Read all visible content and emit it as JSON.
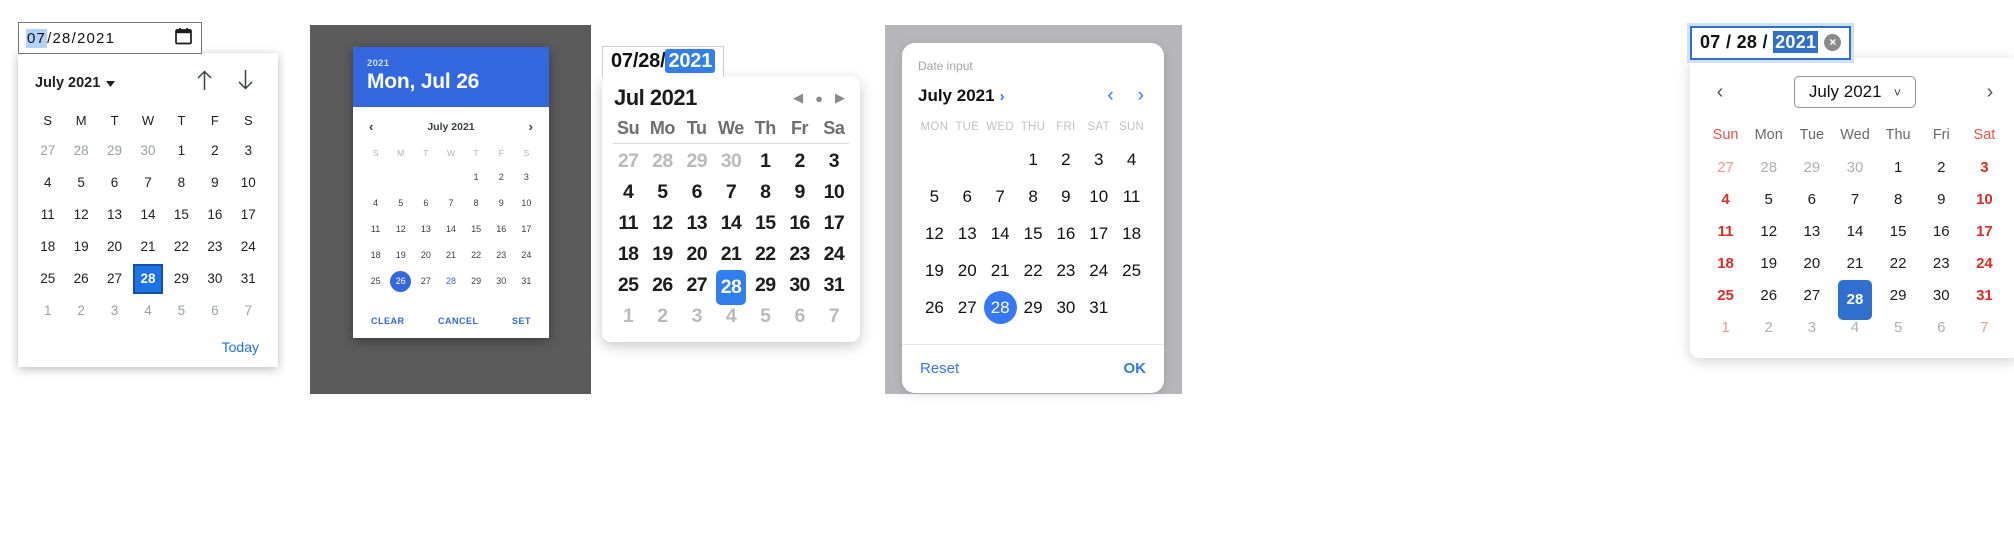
{
  "pickers": [
    {
      "id": "chrome-desktop",
      "input": {
        "month": "07",
        "sep1": "/",
        "day": "28",
        "sep2": "/",
        "year": "2021",
        "selected_segment": "month",
        "icon": "calendar-icon"
      },
      "header": {
        "title": "July 2021",
        "dropdown_icon": "caret-down-icon",
        "prev_icon": "arrow-up-icon",
        "next_icon": "arrow-down-icon"
      },
      "dow": [
        "S",
        "M",
        "T",
        "W",
        "T",
        "F",
        "S"
      ],
      "weeks": [
        [
          {
            "d": "27",
            "m": true
          },
          {
            "d": "28",
            "m": true
          },
          {
            "d": "29",
            "m": true
          },
          {
            "d": "30",
            "m": true
          },
          {
            "d": "1"
          },
          {
            "d": "2"
          },
          {
            "d": "3"
          }
        ],
        [
          {
            "d": "4"
          },
          {
            "d": "5"
          },
          {
            "d": "6"
          },
          {
            "d": "7"
          },
          {
            "d": "8"
          },
          {
            "d": "9"
          },
          {
            "d": "10"
          }
        ],
        [
          {
            "d": "11"
          },
          {
            "d": "12"
          },
          {
            "d": "13"
          },
          {
            "d": "14"
          },
          {
            "d": "15"
          },
          {
            "d": "16"
          },
          {
            "d": "17"
          }
        ],
        [
          {
            "d": "18"
          },
          {
            "d": "19"
          },
          {
            "d": "20"
          },
          {
            "d": "21"
          },
          {
            "d": "22"
          },
          {
            "d": "23"
          },
          {
            "d": "24"
          }
        ],
        [
          {
            "d": "25"
          },
          {
            "d": "26"
          },
          {
            "d": "27"
          },
          {
            "d": "28",
            "s": true
          },
          {
            "d": "29"
          },
          {
            "d": "30"
          },
          {
            "d": "31"
          }
        ],
        [
          {
            "d": "1",
            "m": true
          },
          {
            "d": "2",
            "m": true
          },
          {
            "d": "3",
            "m": true
          },
          {
            "d": "4",
            "m": true
          },
          {
            "d": "5",
            "m": true
          },
          {
            "d": "6",
            "m": true
          },
          {
            "d": "7",
            "m": true
          }
        ]
      ],
      "footer": {
        "today_label": "Today"
      },
      "accent": "#1a73e8"
    },
    {
      "id": "material-dialog",
      "header": {
        "year": "2021",
        "date": "Mon, Jul 26"
      },
      "nav": {
        "prev_icon": "chevron-left-icon",
        "title": "July 2021",
        "next_icon": "chevron-right-icon"
      },
      "dow": [
        "S",
        "M",
        "T",
        "W",
        "T",
        "F",
        "S"
      ],
      "weeks": [
        [
          {
            "d": ""
          },
          {
            "d": ""
          },
          {
            "d": ""
          },
          {
            "d": ""
          },
          {
            "d": "1"
          },
          {
            "d": "2"
          },
          {
            "d": "3"
          }
        ],
        [
          {
            "d": "4"
          },
          {
            "d": "5"
          },
          {
            "d": "6"
          },
          {
            "d": "7"
          },
          {
            "d": "8"
          },
          {
            "d": "9"
          },
          {
            "d": "10"
          }
        ],
        [
          {
            "d": "11"
          },
          {
            "d": "12"
          },
          {
            "d": "13"
          },
          {
            "d": "14"
          },
          {
            "d": "15"
          },
          {
            "d": "16"
          },
          {
            "d": "17"
          }
        ],
        [
          {
            "d": "18"
          },
          {
            "d": "19"
          },
          {
            "d": "20"
          },
          {
            "d": "21"
          },
          {
            "d": "22"
          },
          {
            "d": "23"
          },
          {
            "d": "24"
          }
        ],
        [
          {
            "d": "25"
          },
          {
            "d": "26",
            "s": true
          },
          {
            "d": "27"
          },
          {
            "d": "28",
            "t": true
          },
          {
            "d": "29"
          },
          {
            "d": "30"
          },
          {
            "d": "31"
          }
        ]
      ],
      "actions": {
        "clear": "CLEAR",
        "cancel": "CANCEL",
        "set": "SET"
      },
      "accent": "#3367e0",
      "scrim": "#5b5b5b"
    },
    {
      "id": "macos-safari",
      "input": {
        "month": "07",
        "sep1": "/",
        "day": "28",
        "sep2": "/",
        "year": "2021",
        "selected_segment": "year"
      },
      "header": {
        "title": "Jul 2021",
        "prev_icon": "triangle-left-icon",
        "today_icon": "dot-icon",
        "next_icon": "triangle-right-icon"
      },
      "dow": [
        "Su",
        "Mo",
        "Tu",
        "We",
        "Th",
        "Fr",
        "Sa"
      ],
      "weeks": [
        [
          {
            "d": "27",
            "m": true
          },
          {
            "d": "28",
            "m": true
          },
          {
            "d": "29",
            "m": true
          },
          {
            "d": "30",
            "m": true
          },
          {
            "d": "1"
          },
          {
            "d": "2"
          },
          {
            "d": "3"
          }
        ],
        [
          {
            "d": "4"
          },
          {
            "d": "5"
          },
          {
            "d": "6"
          },
          {
            "d": "7"
          },
          {
            "d": "8"
          },
          {
            "d": "9"
          },
          {
            "d": "10"
          }
        ],
        [
          {
            "d": "11"
          },
          {
            "d": "12"
          },
          {
            "d": "13"
          },
          {
            "d": "14"
          },
          {
            "d": "15"
          },
          {
            "d": "16"
          },
          {
            "d": "17"
          }
        ],
        [
          {
            "d": "18"
          },
          {
            "d": "19"
          },
          {
            "d": "20"
          },
          {
            "d": "21"
          },
          {
            "d": "22"
          },
          {
            "d": "23"
          },
          {
            "d": "24"
          }
        ],
        [
          {
            "d": "25"
          },
          {
            "d": "26"
          },
          {
            "d": "27"
          },
          {
            "d": "28",
            "s": true
          },
          {
            "d": "29"
          },
          {
            "d": "30"
          },
          {
            "d": "31"
          }
        ],
        [
          {
            "d": "1",
            "m": true
          },
          {
            "d": "2",
            "m": true
          },
          {
            "d": "3",
            "m": true
          },
          {
            "d": "4",
            "m": true
          },
          {
            "d": "5",
            "m": true
          },
          {
            "d": "6",
            "m": true
          },
          {
            "d": "7",
            "m": true
          }
        ]
      ],
      "accent": "#2f7ff0"
    },
    {
      "id": "ios-card",
      "label": "Date input",
      "header": {
        "title": "July 2021",
        "expand_icon": "chevron-right-icon",
        "prev_icon": "chevron-left-icon",
        "next_icon": "chevron-right-icon"
      },
      "dow": [
        "MON",
        "TUE",
        "WED",
        "THU",
        "FRI",
        "SAT",
        "SUN"
      ],
      "weeks": [
        [
          {
            "d": ""
          },
          {
            "d": ""
          },
          {
            "d": ""
          },
          {
            "d": "1"
          },
          {
            "d": "2"
          },
          {
            "d": "3"
          },
          {
            "d": "4"
          }
        ],
        [
          {
            "d": "5"
          },
          {
            "d": "6"
          },
          {
            "d": "7"
          },
          {
            "d": "8"
          },
          {
            "d": "9"
          },
          {
            "d": "10"
          },
          {
            "d": "11"
          }
        ],
        [
          {
            "d": "12"
          },
          {
            "d": "13"
          },
          {
            "d": "14"
          },
          {
            "d": "15"
          },
          {
            "d": "16"
          },
          {
            "d": "17"
          },
          {
            "d": "18"
          }
        ],
        [
          {
            "d": "19"
          },
          {
            "d": "20"
          },
          {
            "d": "21"
          },
          {
            "d": "22"
          },
          {
            "d": "23"
          },
          {
            "d": "24"
          },
          {
            "d": "25"
          }
        ],
        [
          {
            "d": "26"
          },
          {
            "d": "27"
          },
          {
            "d": "28",
            "s": true
          },
          {
            "d": "29"
          },
          {
            "d": "30"
          },
          {
            "d": "31"
          },
          {
            "d": ""
          }
        ]
      ],
      "actions": {
        "reset": "Reset",
        "ok": "OK"
      },
      "accent": "#3478f6",
      "background": "#b7b7bb"
    },
    {
      "id": "firefox-windows",
      "input": {
        "month": "07",
        "sep1": "/",
        "day": "28",
        "sep2": "/",
        "year": "2021",
        "selected_segment": "year",
        "clear_icon": "clear-circle-icon"
      },
      "header": {
        "prev_icon": "chevron-left-icon",
        "month_select": "July 2021",
        "select_caret_icon": "chevron-down-icon",
        "next_icon": "chevron-right-icon"
      },
      "dow": [
        "Sun",
        "Mon",
        "Tue",
        "Wed",
        "Thu",
        "Fri",
        "Sat"
      ],
      "weeks": [
        [
          {
            "d": "27",
            "m": true,
            "w": true
          },
          {
            "d": "28",
            "m": true
          },
          {
            "d": "29",
            "m": true
          },
          {
            "d": "30",
            "m": true
          },
          {
            "d": "1"
          },
          {
            "d": "2"
          },
          {
            "d": "3",
            "w": true
          }
        ],
        [
          {
            "d": "4",
            "w": true
          },
          {
            "d": "5"
          },
          {
            "d": "6"
          },
          {
            "d": "7"
          },
          {
            "d": "8"
          },
          {
            "d": "9"
          },
          {
            "d": "10",
            "w": true
          }
        ],
        [
          {
            "d": "11",
            "w": true
          },
          {
            "d": "12"
          },
          {
            "d": "13"
          },
          {
            "d": "14"
          },
          {
            "d": "15"
          },
          {
            "d": "16"
          },
          {
            "d": "17",
            "w": true
          }
        ],
        [
          {
            "d": "18",
            "w": true
          },
          {
            "d": "19"
          },
          {
            "d": "20"
          },
          {
            "d": "21"
          },
          {
            "d": "22"
          },
          {
            "d": "23"
          },
          {
            "d": "24",
            "w": true
          }
        ],
        [
          {
            "d": "25",
            "w": true
          },
          {
            "d": "26"
          },
          {
            "d": "27"
          },
          {
            "d": "28",
            "s": true
          },
          {
            "d": "29"
          },
          {
            "d": "30"
          },
          {
            "d": "31",
            "w": true
          }
        ],
        [
          {
            "d": "1",
            "m": true,
            "w": true
          },
          {
            "d": "2",
            "m": true
          },
          {
            "d": "3",
            "m": true
          },
          {
            "d": "4",
            "m": true
          },
          {
            "d": "5",
            "m": true
          },
          {
            "d": "6",
            "m": true
          },
          {
            "d": "7",
            "m": true,
            "w": true
          }
        ]
      ],
      "accent": "#2f6fd0",
      "weekend_color": "#e02b20"
    }
  ]
}
